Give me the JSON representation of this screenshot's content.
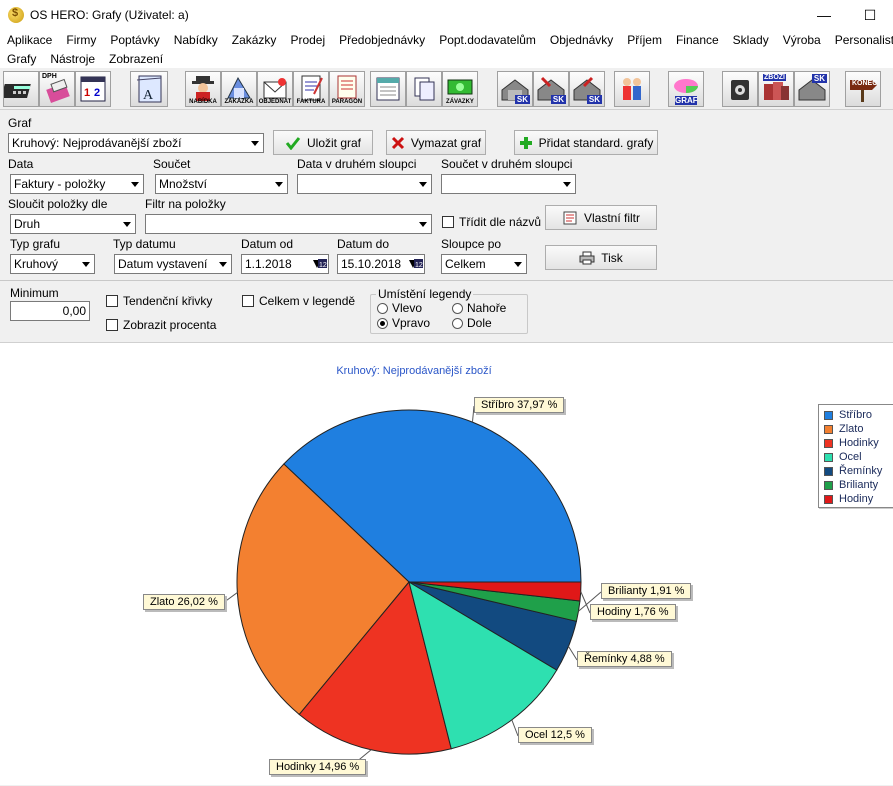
{
  "window": {
    "title": "OS HERO: Grafy  (Uživatel: a)"
  },
  "menu": {
    "row1": [
      "Aplikace",
      "Firmy",
      "Poptávky",
      "Nabídky",
      "Zakázky",
      "Prodej",
      "Předobjednávky",
      "Popt.dodavatelům",
      "Objednávky",
      "Příjem",
      "Finance",
      "Sklady",
      "Výroba",
      "Personalistika"
    ],
    "row2": [
      "Grafy",
      "Nástroje",
      "Zobrazení"
    ]
  },
  "toolbar": {
    "dph": "DPH",
    "nabidka": "NABÍDKA",
    "zakazka": "ZAKÁZKA",
    "objednat": "OBJEDNAT",
    "faktura": "FAKTURA",
    "paragon": "PARAGON",
    "zavazky": "ZÁVAZKY",
    "sk": "SK",
    "graf": "GRAF",
    "zbozi": "ZBOŽÍ",
    "konec": "KONEC"
  },
  "form": {
    "graf_label": "Graf",
    "graf_value": "Kruhový: Nejprodávanější zboží",
    "save_label": "Uložit graf",
    "delete_label": "Vymazat graf",
    "add_label": "Přidat standard. grafy",
    "data_label": "Data",
    "data_value": "Faktury - položky",
    "soucet_label": "Součet",
    "soucet_value": "Množství",
    "data2_label": "Data v druhém sloupci",
    "data2_value": "",
    "soucet2_label": "Součet v druhém sloupci",
    "soucet2_value": "",
    "sloucit_label": "Sloučit položky dle",
    "sloucit_value": "Druh",
    "filtr_label": "Filtr na položky",
    "filtr_value": "",
    "tridit_label": "Třídit dle názvů",
    "vlastni_filtr_label": "Vlastní filtr",
    "typ_grafu_label": "Typ grafu",
    "typ_grafu_value": "Kruhový",
    "typ_datumu_label": "Typ datumu",
    "typ_datumu_value": "Datum vystavení",
    "datum_od_label": "Datum od",
    "datum_od_value": "1.1.2018",
    "datum_do_label": "Datum do",
    "datum_do_value": "15.10.2018",
    "calendar_badge": "12",
    "sloupce_label": "Sloupce po",
    "sloupce_value": "Celkem",
    "tisk_label": "Tisk",
    "minimum_label": "Minimum",
    "minimum_value": "0,00",
    "tendencni_label": "Tendenční křivky",
    "zobrazit_procenta_label": "Zobrazit procenta",
    "celkem_legenda_label": "Celkem v legendě",
    "umisteni_label": "Umístění legendy",
    "radio_vlevo": "Vlevo",
    "radio_nahore": "Nahoře",
    "radio_vpravo": "Vpravo",
    "radio_dole": "Dole"
  },
  "chart_data": {
    "type": "pie",
    "title": "Kruhový: Nejprodávanější zboží",
    "categories": [
      "Stříbro",
      "Zlato",
      "Hodinky",
      "Ocel",
      "Řemínky",
      "Brilianty",
      "Hodiny"
    ],
    "values": [
      37.97,
      26.02,
      14.96,
      12.5,
      4.88,
      1.91,
      1.76
    ],
    "colors": [
      "#1f7fe0",
      "#f38030",
      "#ee3322",
      "#2ee0b0",
      "#124a80",
      "#1fa04a",
      "#e01818"
    ],
    "labels": [
      "Stříbro 37,97 %",
      "Zlato 26,02 %",
      "Hodinky 14,96 %",
      "Ocel 12,5 %",
      "Řemínky 4,88 %",
      "Brilianty 1,91 %",
      "Hodiny 1,76 %"
    ],
    "legend_position": "right"
  }
}
